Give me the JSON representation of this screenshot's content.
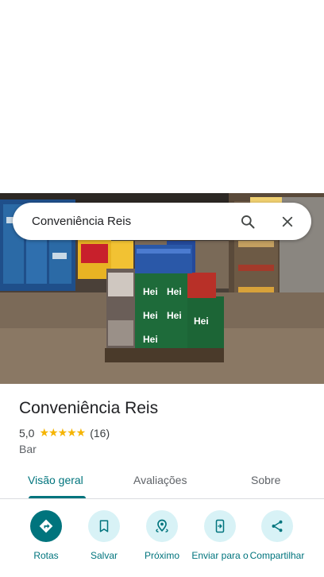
{
  "search": {
    "query": "Conveniência Reis"
  },
  "place": {
    "name": "Conveniência Reis",
    "rating": "5,0",
    "stars": "★★★★★",
    "review_count": "(16)",
    "category": "Bar"
  },
  "tabs": [
    {
      "label": "Visão geral",
      "active": true
    },
    {
      "label": "Avaliações",
      "active": false
    },
    {
      "label": "Sobre",
      "active": false
    }
  ],
  "actions": [
    {
      "label": "Rotas",
      "icon": "directions-icon"
    },
    {
      "label": "Salvar",
      "icon": "bookmark-icon"
    },
    {
      "label": "Próximo",
      "icon": "nearby-icon"
    },
    {
      "label": "Enviar para o",
      "icon": "send-to-phone-icon"
    },
    {
      "label": "Compartilhar",
      "icon": "share-icon"
    }
  ],
  "photo": {
    "pack_labels": [
      "Hei",
      "Hei",
      "Hei",
      "Hei",
      "Hei",
      "Hei"
    ]
  },
  "colors": {
    "accent": "#00747d",
    "action_bg": "#d8f2f6",
    "star": "#f5b400"
  }
}
